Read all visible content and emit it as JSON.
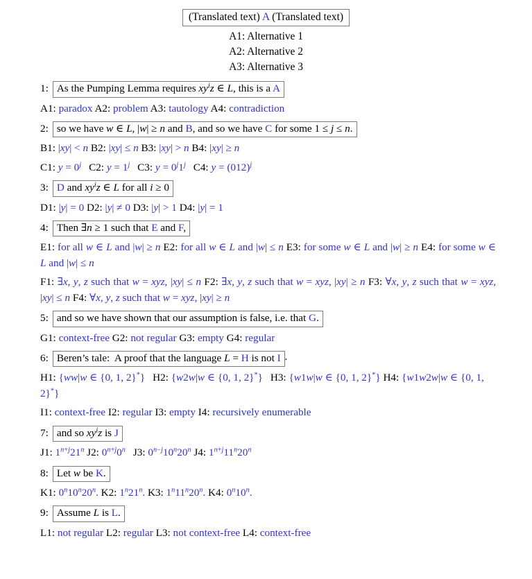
{
  "header": {
    "title_pre": "(Translated text)",
    "title_key": "A",
    "title_post": "(Translated text)",
    "alternatives": [
      "A1:  Alternative 1",
      "A2:  Alternative 2",
      "A3:  Alternative 3"
    ]
  },
  "colors": {
    "blue": "#3333cc",
    "box_border": "#7b7b7b",
    "text": "#000000"
  },
  "questions": [
    {
      "num": "1:",
      "stem_parts": [
        {
          "t": "As the Pumping Lemma requires ",
          "s": "plain"
        },
        {
          "t": "xy",
          "s": "math"
        },
        {
          "t": "i",
          "s": "sup-math"
        },
        {
          "t": "z",
          "s": "math"
        },
        {
          "t": " ∈ ",
          "s": "plain"
        },
        {
          "t": "L",
          "s": "math"
        },
        {
          "t": ", this is a ",
          "s": "plain"
        },
        {
          "t": "A",
          "s": "blue"
        }
      ],
      "options_lines": [
        [
          {
            "t": "A1: ",
            "s": "plain"
          },
          {
            "t": "paradox",
            "s": "blue"
          },
          {
            "t": " A2: ",
            "s": "plain"
          },
          {
            "t": "problem",
            "s": "blue"
          },
          {
            "t": " A3: ",
            "s": "plain"
          },
          {
            "t": "tautology",
            "s": "blue"
          },
          {
            "t": " A4: ",
            "s": "plain"
          },
          {
            "t": "contradiction",
            "s": "blue"
          }
        ]
      ]
    },
    {
      "num": "2:",
      "stem_parts": [
        {
          "t": "so we have ",
          "s": "plain"
        },
        {
          "t": "w",
          "s": "math"
        },
        {
          "t": " ∈ ",
          "s": "plain"
        },
        {
          "t": "L",
          "s": "math"
        },
        {
          "t": ", |",
          "s": "plain"
        },
        {
          "t": "w",
          "s": "math"
        },
        {
          "t": "| ≥ ",
          "s": "plain"
        },
        {
          "t": "n",
          "s": "math"
        },
        {
          "t": " and ",
          "s": "plain"
        },
        {
          "t": "B",
          "s": "blue"
        },
        {
          "t": ", and so we have ",
          "s": "plain"
        },
        {
          "t": "C",
          "s": "blue"
        },
        {
          "t": " for some 1 ≤ ",
          "s": "plain"
        },
        {
          "t": "j",
          "s": "math"
        },
        {
          "t": " ≤ ",
          "s": "plain"
        },
        {
          "t": "n",
          "s": "math"
        },
        {
          "t": ".",
          "s": "plain"
        }
      ],
      "options_lines": [
        [
          {
            "t": "B1: ",
            "s": "plain"
          },
          {
            "t": "|xy| < n",
            "s": "blue-math-xy-lt"
          },
          {
            "t": " B2: ",
            "s": "plain"
          },
          {
            "t": "|xy| ≤ n",
            "s": "blue-math-xy-le"
          },
          {
            "t": " B3: ",
            "s": "plain"
          },
          {
            "t": "|xy| > n",
            "s": "blue-math-xy-gt"
          },
          {
            "t": " B4: ",
            "s": "plain"
          },
          {
            "t": "|xy| ≥ n",
            "s": "blue-math-xy-ge"
          }
        ],
        [
          {
            "t": "C1: ",
            "s": "plain"
          },
          {
            "t": "y = 0^j",
            "s": "blue-c1"
          },
          {
            "t": " C2: ",
            "s": "plain"
          },
          {
            "t": "y = 1^j",
            "s": "blue-c2"
          },
          {
            "t": " C3: ",
            "s": "plain"
          },
          {
            "t": "y = 0^j 1^j",
            "s": "blue-c3"
          },
          {
            "t": " C4: ",
            "s": "plain"
          },
          {
            "t": "y = (012)^j",
            "s": "blue-c4"
          }
        ]
      ]
    },
    {
      "num": "3:",
      "stem_parts": [
        {
          "t": "D",
          "s": "blue"
        },
        {
          "t": " and ",
          "s": "plain"
        },
        {
          "t": "xy",
          "s": "math"
        },
        {
          "t": "i",
          "s": "sup-math"
        },
        {
          "t": "z",
          "s": "math"
        },
        {
          "t": " ∈ ",
          "s": "plain"
        },
        {
          "t": "L",
          "s": "math"
        },
        {
          "t": " for all ",
          "s": "plain"
        },
        {
          "t": "i",
          "s": "math"
        },
        {
          "t": " ≥ 0",
          "s": "plain"
        }
      ],
      "options_lines": [
        [
          {
            "t": "D1: ",
            "s": "plain"
          },
          {
            "t": "|y| = 0",
            "s": "blue-d1"
          },
          {
            "t": " D2: ",
            "s": "plain"
          },
          {
            "t": "|y| ≠ 0",
            "s": "blue-d2"
          },
          {
            "t": " D3: ",
            "s": "plain"
          },
          {
            "t": "|y| > 1",
            "s": "blue-d3"
          },
          {
            "t": " D4: ",
            "s": "plain"
          },
          {
            "t": "|y| = 1",
            "s": "blue-d4"
          }
        ]
      ]
    },
    {
      "num": "4:",
      "stem_parts": [
        {
          "t": "Then ∃",
          "s": "plain"
        },
        {
          "t": "n",
          "s": "math"
        },
        {
          "t": " ≥ 1 such that ",
          "s": "plain"
        },
        {
          "t": "E",
          "s": "blue"
        },
        {
          "t": " and ",
          "s": "plain"
        },
        {
          "t": "F",
          "s": "blue"
        },
        {
          "t": ",",
          "s": "plain"
        }
      ],
      "options_lines": [
        [
          {
            "t": "E1: ",
            "s": "plain"
          },
          {
            "t": "for all w ∈ L and |w| ≥ n",
            "s": "blue-e1"
          },
          {
            "t": " E2: ",
            "s": "plain"
          },
          {
            "t": "for all w ∈ L and |w| ≤ n",
            "s": "blue-e2"
          },
          {
            "t": " E3: ",
            "s": "plain"
          },
          {
            "t": "for some w ∈ L and |w| ≥ n",
            "s": "blue-e3"
          },
          {
            "t": " E4: ",
            "s": "plain"
          },
          {
            "t": "for some w ∈ L and |w| ≤ n",
            "s": "blue-e4"
          }
        ],
        [
          {
            "t": "F1: ",
            "s": "plain"
          },
          {
            "t": "∃x, y, z such that w = xyz, |xy| ≤ n",
            "s": "blue-f1"
          },
          {
            "t": " F2: ",
            "s": "plain"
          },
          {
            "t": "∃x, y, z such that w = xyz, |xy| ≥ n",
            "s": "blue-f2"
          },
          {
            "t": " F3: ",
            "s": "plain"
          },
          {
            "t": "∀x, y, z such that w = xyz, |xy| ≤ n",
            "s": "blue-f3"
          },
          {
            "t": " F4: ",
            "s": "plain"
          },
          {
            "t": "∀x, y, z such that w = xyz, |xy| ≥ n",
            "s": "blue-f4"
          }
        ]
      ]
    },
    {
      "num": "5:",
      "stem_parts": [
        {
          "t": "and so we have shown that our assumption is false, i.e. that ",
          "s": "plain"
        },
        {
          "t": "G",
          "s": "blue"
        },
        {
          "t": ".",
          "s": "plain"
        }
      ],
      "options_lines": [
        [
          {
            "t": "G1: ",
            "s": "plain"
          },
          {
            "t": "context-free",
            "s": "blue"
          },
          {
            "t": " G2: ",
            "s": "plain"
          },
          {
            "t": "not regular",
            "s": "blue"
          },
          {
            "t": " G3: ",
            "s": "plain"
          },
          {
            "t": "empty",
            "s": "blue"
          },
          {
            "t": " G4: ",
            "s": "plain"
          },
          {
            "t": "regular",
            "s": "blue"
          }
        ]
      ]
    },
    {
      "num": "6:",
      "stem_parts": [
        {
          "t": "Beren's tale:  A proof that the language ",
          "s": "plain"
        },
        {
          "t": "L",
          "s": "math"
        },
        {
          "t": " = ",
          "s": "plain"
        },
        {
          "t": "H",
          "s": "blue"
        },
        {
          "t": " is not ",
          "s": "plain"
        },
        {
          "t": "I",
          "s": "blue"
        }
      ],
      "stem_suffix": ".",
      "options_lines": [
        [
          {
            "t": "H1: ",
            "s": "plain"
          },
          {
            "t": "{ww|w ∈ {0, 1, 2}*}",
            "s": "blue-h1"
          },
          {
            "t": " H2: ",
            "s": "plain"
          },
          {
            "t": "{w2w|w ∈ {0, 1, 2}*}",
            "s": "blue-h2"
          },
          {
            "t": " H3: ",
            "s": "plain"
          },
          {
            "t": "{w1w|w ∈ {0, 1, 2}*}",
            "s": "blue-h3"
          },
          {
            "t": " H4: ",
            "s": "plain"
          },
          {
            "t": "{w1w2w|w ∈ {0, 1, 2}*}",
            "s": "blue-h4"
          }
        ],
        [
          {
            "t": "I1: ",
            "s": "plain"
          },
          {
            "t": "context-free",
            "s": "blue"
          },
          {
            "t": " I2: ",
            "s": "plain"
          },
          {
            "t": "regular",
            "s": "blue"
          },
          {
            "t": " I3: ",
            "s": "plain"
          },
          {
            "t": "empty",
            "s": "blue"
          },
          {
            "t": " I4: ",
            "s": "plain"
          },
          {
            "t": "recursively enumerable",
            "s": "blue"
          }
        ]
      ]
    },
    {
      "num": "7:",
      "stem_parts": [
        {
          "t": "and so ",
          "s": "plain"
        },
        {
          "t": "xy",
          "s": "math"
        },
        {
          "t": "i",
          "s": "sup-math"
        },
        {
          "t": "z",
          "s": "math"
        },
        {
          "t": " is ",
          "s": "plain"
        },
        {
          "t": "J",
          "s": "blue"
        }
      ],
      "options_lines": [
        [
          {
            "t": "J1: ",
            "s": "plain"
          },
          {
            "t": "1^{n+j}21^n",
            "s": "blue-j1"
          },
          {
            "t": " J2: ",
            "s": "plain"
          },
          {
            "t": "0^{n+j}0^n",
            "s": "blue-j2"
          },
          {
            "t": " J3: ",
            "s": "plain"
          },
          {
            "t": "0^{n-j}10^n20^n",
            "s": "blue-j3"
          },
          {
            "t": " J4: ",
            "s": "plain"
          },
          {
            "t": "1^{n+j}11^n20^n",
            "s": "blue-j4"
          }
        ]
      ]
    },
    {
      "num": "8:",
      "stem_parts": [
        {
          "t": "Let ",
          "s": "plain"
        },
        {
          "t": "w",
          "s": "math"
        },
        {
          "t": " be ",
          "s": "plain"
        },
        {
          "t": "K",
          "s": "blue"
        },
        {
          "t": ".",
          "s": "plain"
        }
      ],
      "options_lines": [
        [
          {
            "t": "K1: ",
            "s": "plain"
          },
          {
            "t": "0^n10^n20^n.",
            "s": "blue-k1"
          },
          {
            "t": " K2: ",
            "s": "plain"
          },
          {
            "t": "1^n21^n.",
            "s": "blue-k2"
          },
          {
            "t": " K3: ",
            "s": "plain"
          },
          {
            "t": "1^n11^n20^n.",
            "s": "blue-k3"
          },
          {
            "t": " K4: ",
            "s": "plain"
          },
          {
            "t": "0^n10^n.",
            "s": "blue-k4"
          }
        ]
      ]
    },
    {
      "num": "9:",
      "stem_parts": [
        {
          "t": "Assume ",
          "s": "plain"
        },
        {
          "t": "L",
          "s": "math"
        },
        {
          "t": " is ",
          "s": "plain"
        },
        {
          "t": "L",
          "s": "blue"
        },
        {
          "t": ".",
          "s": "plain"
        }
      ],
      "options_lines": [
        [
          {
            "t": "L1: ",
            "s": "plain"
          },
          {
            "t": "not regular",
            "s": "blue"
          },
          {
            "t": " L2: ",
            "s": "plain"
          },
          {
            "t": "regular",
            "s": "blue"
          },
          {
            "t": " L3: ",
            "s": "plain"
          },
          {
            "t": "not context-free",
            "s": "blue"
          },
          {
            "t": " L4: ",
            "s": "plain"
          },
          {
            "t": "context-free",
            "s": "blue"
          }
        ]
      ]
    }
  ]
}
